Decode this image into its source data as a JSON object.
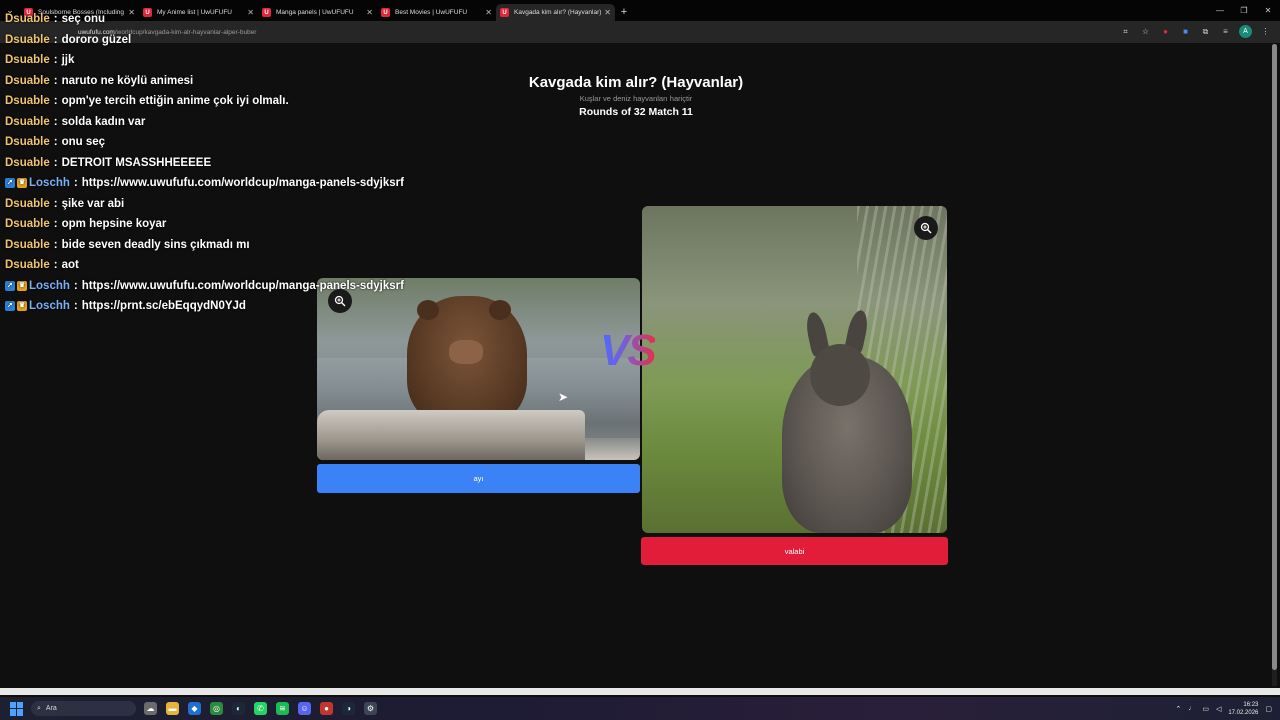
{
  "browser": {
    "tabs": [
      {
        "label": "Soulsborne Bosses (Including F",
        "active": false
      },
      {
        "label": "My Anime list | UwUFUFU",
        "active": false
      },
      {
        "label": "Manga panels | UwUFUFU",
        "active": false
      },
      {
        "label": "Best Movies | UwUFUFU",
        "active": false
      },
      {
        "label": "Kavgada kim alır? (Hayvanlar) |",
        "active": true
      }
    ],
    "new_tab": "+",
    "url_domain": "uwufufu.com",
    "url_path": "/worldcup/kavgada-kim-alr-hayvanlar-alper-buber"
  },
  "chat": {
    "messages": [
      {
        "author": "Dsuable",
        "text": "seç onu",
        "badges": false
      },
      {
        "author": "Dsuable",
        "text": "dororo güzel",
        "badges": false
      },
      {
        "author": "Dsuable",
        "text": "jjk",
        "badges": false
      },
      {
        "author": "Dsuable",
        "text": "naruto ne köylü animesi",
        "badges": false
      },
      {
        "author": "Dsuable",
        "text": "opm'ye tercih ettiğin anime çok iyi olmalı.",
        "badges": false
      },
      {
        "author": "Dsuable",
        "text": "solda kadın var",
        "badges": false
      },
      {
        "author": "Dsuable",
        "text": "onu seç",
        "badges": false
      },
      {
        "author": "Dsuable",
        "text": "DETROIT MSASSHHEEEEE",
        "badges": false
      },
      {
        "author": "Loschh",
        "text": "https://www.uwufufu.com/worldcup/manga-panels-sdyjksrf",
        "badges": true
      },
      {
        "author": "Dsuable",
        "text": "şike var abi",
        "badges": false
      },
      {
        "author": "Dsuable",
        "text": "opm hepsine koyar",
        "badges": false
      },
      {
        "author": "Dsuable",
        "text": "bide seven deadly sins çıkmadı mı",
        "badges": false
      },
      {
        "author": "Dsuable",
        "text": "aot",
        "badges": false
      },
      {
        "author": "Loschh",
        "text": "https://www.uwufufu.com/worldcup/manga-panels-sdyjksrf",
        "badges": true
      },
      {
        "author": "Loschh",
        "text": "https://prnt.sc/ebEqqydN0YJd",
        "badges": true
      }
    ]
  },
  "game": {
    "title": "Kavgada kim alır? (Hayvanlar)",
    "subtitle": "Kuşlar ve deniz hayvanları hariçtir",
    "round": "Rounds of 32 Match 11",
    "vs": "VS",
    "left_choice": "ayı",
    "right_choice": "valabi"
  },
  "taskbar": {
    "search_placeholder": "Ara",
    "time": "16:23",
    "date": "17.02.2026"
  },
  "colors": {
    "left_button": "#3b82f6",
    "right_button": "#e11d3a",
    "chat_author": "#f1c46e"
  },
  "icons": {
    "zoom": "zoom-in-icon",
    "windows": "windows-start-icon",
    "search": "search-icon"
  }
}
